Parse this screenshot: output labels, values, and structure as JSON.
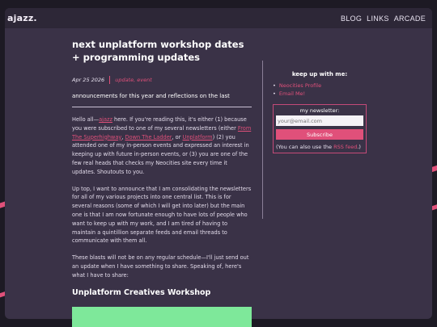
{
  "site": {
    "logo": "ajazz.",
    "nav": [
      "BLOG",
      "LINKS",
      "ARCADE"
    ]
  },
  "post": {
    "title": "next unplatform workshop dates + programming updates",
    "date": "Apr 25 2026",
    "tags": "update, event",
    "subtitle": "announcements for this year and reflections on the last",
    "p1": {
      "a": "Hello all—",
      "link_ajazz": "ajazz",
      "b": " here. If you're reading this, it's either (1) because you were subscribed to one of my several newsletters (either ",
      "link_sup": "From The Superhighway",
      "c": ", ",
      "link_ladder": "Down The Ladder",
      "d": ", or ",
      "link_unp": "Unplatform",
      "e": ") (2) you attended one of my in-person events and expressed an interest in keeping up with future in-person events, or (3) you are one of the few real heads that checks my Neocities site every time it updates. Shoutouts to you."
    },
    "p2": "Up top, I want to announce that I am consolidating the newsletters for all of my various projects into one central list. This is for several reasons (some of which I will get into later) but the main one is that I am now fortunate enough to have lots of people who want to keep up with my work, and I am tired of having to maintain a quintillion separate feeds and email threads to communicate with them all.",
    "p3": "These blasts will not be on any regular schedule—I'll just send out an update when I have something to share. Speaking of, here's what I have to share:",
    "section_title": "Unplatform Creatives Workshop"
  },
  "sidebar": {
    "heading": "keep up with me:",
    "links": [
      "Neocities Profile",
      "Email Me!"
    ],
    "newsletter": {
      "label": "my newsletter:",
      "placeholder": "your@email.com",
      "button": "Subscribe",
      "note_a": "(You can also use the ",
      "note_rss": "RSS feed",
      "note_b": ".)"
    }
  },
  "colors": {
    "accent": "#e0507a",
    "panel": "#3a3247",
    "topbar": "#2d2737",
    "background": "#1d1a24",
    "image_placeholder": "#7ee89a"
  }
}
